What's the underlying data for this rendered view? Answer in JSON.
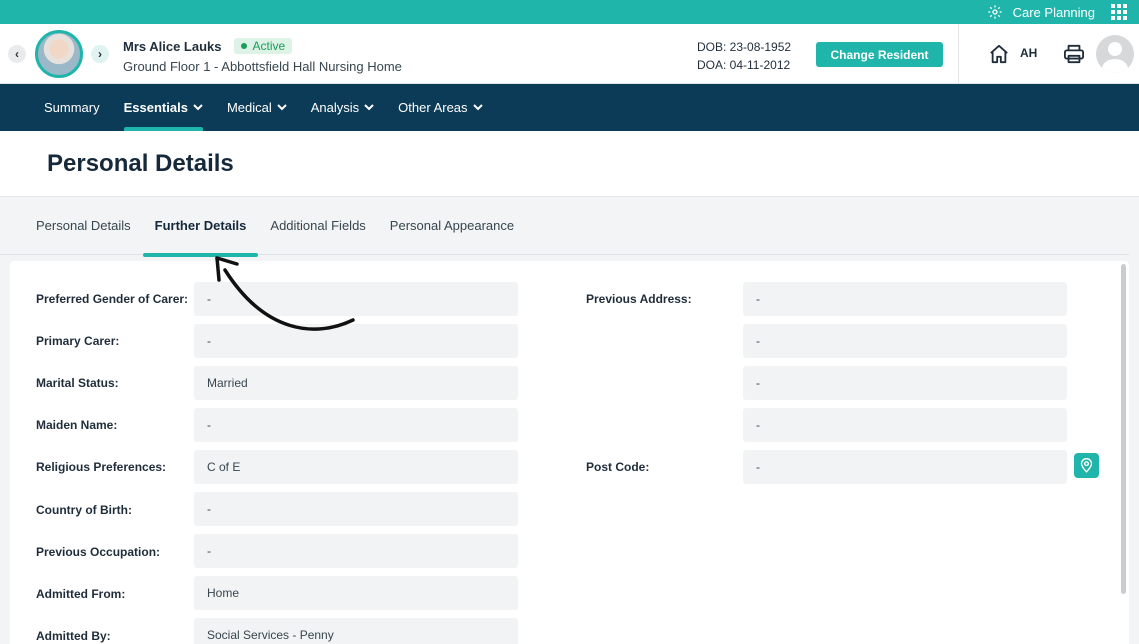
{
  "topbar": {
    "app_label": "Care Planning"
  },
  "resident": {
    "name": "Mrs Alice Lauks",
    "status": "Active",
    "location": "Ground Floor 1 - Abbottsfield Hall Nursing Home",
    "dob": "DOB: 23-08-1952",
    "doa": "DOA: 04-11-2012",
    "change_button": "Change Resident"
  },
  "user": {
    "initials": "AH"
  },
  "nav": {
    "items": [
      {
        "label": "Summary"
      },
      {
        "label": "Essentials"
      },
      {
        "label": "Medical"
      },
      {
        "label": "Analysis"
      },
      {
        "label": "Other Areas"
      }
    ]
  },
  "page": {
    "title": "Personal Details"
  },
  "subtabs": [
    {
      "label": "Personal Details"
    },
    {
      "label": "Further Details"
    },
    {
      "label": "Additional Fields"
    },
    {
      "label": "Personal Appearance"
    }
  ],
  "left_fields": [
    {
      "label": "Preferred Gender of Carer:",
      "value": "-"
    },
    {
      "label": "Primary Carer:",
      "value": "-"
    },
    {
      "label": "Marital Status:",
      "value": "Married"
    },
    {
      "label": "Maiden Name:",
      "value": "-"
    },
    {
      "label": "Religious Preferences:",
      "value": "C of E"
    },
    {
      "label": "Country of Birth:",
      "value": "-"
    },
    {
      "label": "Previous Occupation:",
      "value": "-"
    },
    {
      "label": "Admitted From:",
      "value": "Home"
    },
    {
      "label": "Admitted By:",
      "value": "Social Services - Penny"
    }
  ],
  "right_fields": {
    "previous_address_label": "Previous Address:",
    "address_lines": [
      "-",
      "-",
      "-",
      "-"
    ],
    "post_code_label": "Post Code:",
    "post_code_value": "-"
  },
  "colors": {
    "accent": "#1fb5ab",
    "nav_bg": "#0c3b57",
    "active_green": "#1a9c5b"
  }
}
